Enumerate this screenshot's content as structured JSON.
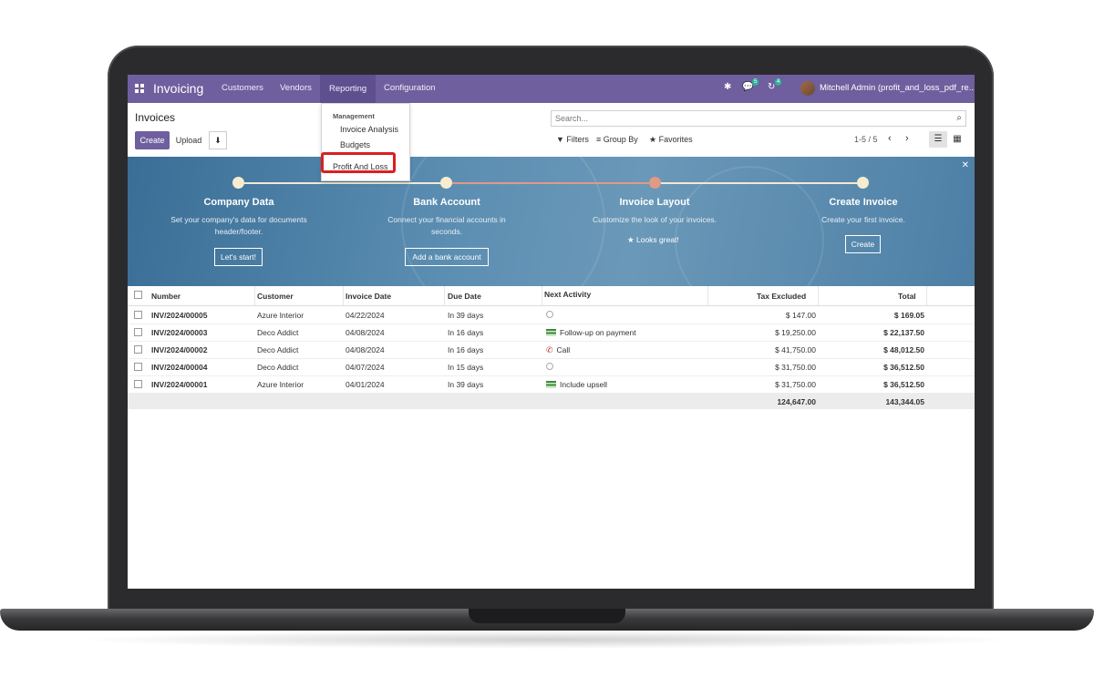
{
  "nav": {
    "brand": "Invoicing",
    "menu": [
      "Customers",
      "Vendors",
      "Reporting",
      "Configuration"
    ],
    "chat_count": "5",
    "activity_count": "4",
    "user": "Mitchell Admin (profit_and_loss_pdf_re..."
  },
  "page": {
    "title": "Invoices",
    "create_label": "Create",
    "upload_label": "Upload",
    "search_placeholder": "Search...",
    "filters_label": "Filters",
    "groupby_label": "Group By",
    "favorites_label": "Favorites",
    "pager": "1-5 / 5"
  },
  "dropdown": {
    "header": "Management",
    "items": [
      "Invoice Analysis",
      "Budgets"
    ],
    "highlighted": "Profit And Loss"
  },
  "onboarding": {
    "steps": [
      {
        "title": "Company Data",
        "desc": "Set your company's data for documents header/footer.",
        "button": "Let's start!"
      },
      {
        "title": "Bank Account",
        "desc": "Connect your financial accounts in seconds.",
        "button": "Add a bank account"
      },
      {
        "title": "Invoice Layout",
        "desc": "Customize the look of your invoices.",
        "note": "Looks great!"
      },
      {
        "title": "Create Invoice",
        "desc": "Create your first invoice.",
        "button": "Create"
      }
    ]
  },
  "table": {
    "headers": [
      "Number",
      "Customer",
      "Invoice Date",
      "Due Date",
      "Next Activity",
      "Tax Excluded",
      "Total"
    ],
    "rows": [
      {
        "number": "INV/2024/00005",
        "customer": "Azure Interior",
        "invoice_date": "04/22/2024",
        "due": "In 39 days",
        "activity": "",
        "activity_icon": "clock-icon",
        "tax_excluded": "$ 147.00",
        "total": "$ 169.05"
      },
      {
        "number": "INV/2024/00003",
        "customer": "Deco Addict",
        "invoice_date": "04/08/2024",
        "due": "In 16 days",
        "activity": "Follow-up on payment",
        "activity_icon": "money-icon",
        "tax_excluded": "$ 19,250.00",
        "total": "$ 22,137.50"
      },
      {
        "number": "INV/2024/00002",
        "customer": "Deco Addict",
        "invoice_date": "04/08/2024",
        "due": "In 16 days",
        "activity": "Call",
        "activity_icon": "phone-icon",
        "tax_excluded": "$ 41,750.00",
        "total": "$ 48,012.50"
      },
      {
        "number": "INV/2024/00004",
        "customer": "Deco Addict",
        "invoice_date": "04/07/2024",
        "due": "In 15 days",
        "activity": "",
        "activity_icon": "clock-icon",
        "tax_excluded": "$ 31,750.00",
        "total": "$ 36,512.50"
      },
      {
        "number": "INV/2024/00001",
        "customer": "Azure Interior",
        "invoice_date": "04/01/2024",
        "due": "In 39 days",
        "activity": "Include upsell",
        "activity_icon": "money-icon",
        "tax_excluded": "$ 31,750.00",
        "total": "$ 36,512.50"
      }
    ],
    "totals": {
      "tax_excluded": "124,647.00",
      "total": "143,344.05"
    }
  },
  "colors": {
    "brand": "#6f5f9e",
    "highlight": "#d92020"
  }
}
